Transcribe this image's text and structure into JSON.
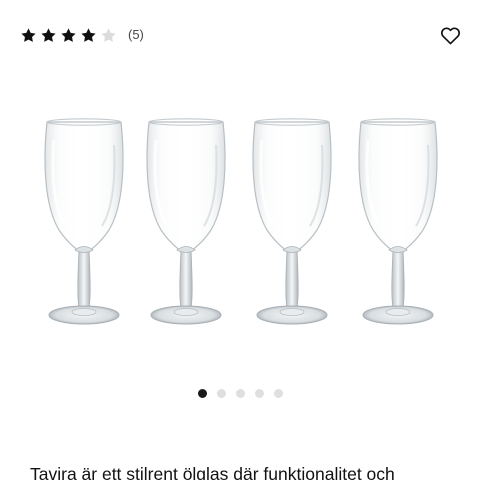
{
  "rating": {
    "stars_filled": 4,
    "stars_total": 5,
    "count_label": "(5)",
    "filled_color": "#111111",
    "empty_color": "#dcdcdc"
  },
  "wishlist": {
    "icon": "heart-outline-icon"
  },
  "product_image": {
    "subject": "four clear stemmed beer glasses",
    "glass_count": 4
  },
  "carousel": {
    "total": 5,
    "active_index": 0
  },
  "description": {
    "text": "Tavira är ett stilrent ölglas där funktionalitet och"
  }
}
